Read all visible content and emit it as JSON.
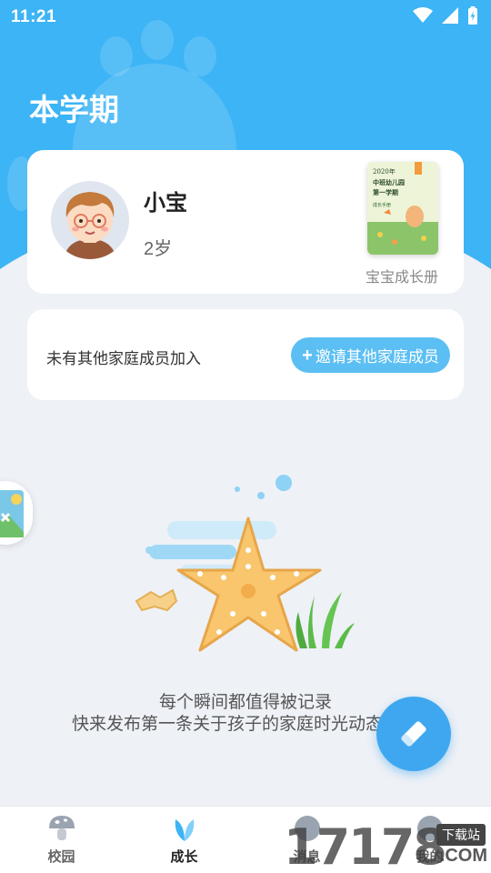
{
  "status_bar": {
    "time": "11:21"
  },
  "header": {
    "title": "本学期"
  },
  "profile": {
    "name": "小宝",
    "age": "2岁",
    "book_label": "宝宝成长册",
    "book_cover": {
      "year": "2020年",
      "line1": "中班幼儿园",
      "line2": "第一学期",
      "footer": "成长手册"
    }
  },
  "family": {
    "message": "未有其他家庭成员加入",
    "invite_plus": "+",
    "invite_label": "邀请其他家庭成员"
  },
  "empty_state": {
    "line1": "每个瞬间都值得被记录",
    "line2": "快来发布第一条关于孩子的家庭时光动态"
  },
  "tabs": [
    {
      "label": "校园",
      "icon": "mushroom-icon"
    },
    {
      "label": "成长",
      "icon": "leaf-icon",
      "active": true
    },
    {
      "label": "消息",
      "icon": "bell-icon"
    },
    {
      "label": "我的",
      "icon": "person-icon"
    }
  ],
  "watermark": {
    "digits": "17178",
    "badge": "下载站",
    "domain": ".COM"
  },
  "colors": {
    "primary": "#3db4f5",
    "fab": "#3fa7ef",
    "invite_button": "#5cbff3",
    "starfish": "#f9c56d",
    "seaweed": "#5cbb4a"
  }
}
